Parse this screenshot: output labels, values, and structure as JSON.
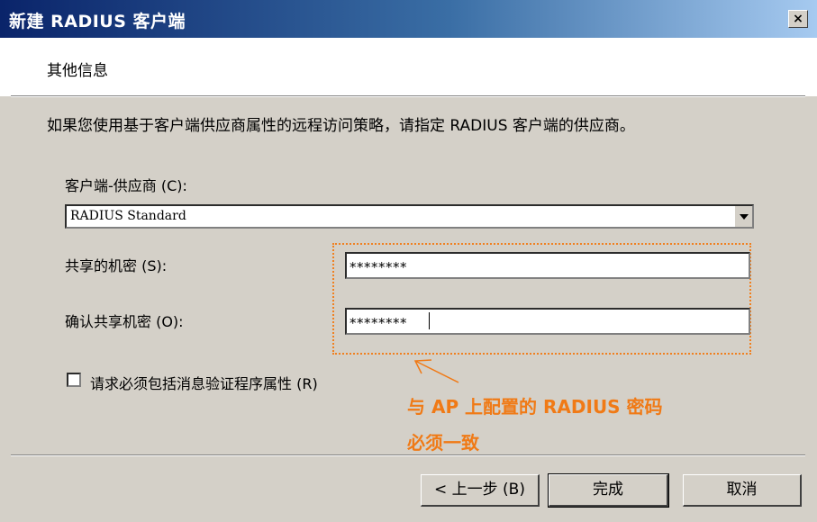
{
  "window": {
    "title": "新建 RADIUS 客户端",
    "close_label": "×"
  },
  "section": {
    "title": "其他信息"
  },
  "description": "如果您使用基于客户端供应商属性的远程访问策略，请指定 RADIUS 客户端的供应商。",
  "vendor": {
    "label": "客户端-供应商 (C):",
    "selected": "RADIUS Standard"
  },
  "shared_secret": {
    "label": "共享的机密 (S):",
    "value": "********"
  },
  "confirm_secret": {
    "label": "确认共享机密 (O):",
    "value": "********"
  },
  "message_auth": {
    "label": "请求必须包括消息验证程序属性 (R)",
    "checked": false
  },
  "annotation": {
    "line1": "与 AP 上配置的 RADIUS 密码",
    "line2": "必须一致",
    "color": "#f07a16"
  },
  "buttons": {
    "back": "< 上一步 (B)",
    "finish": "完成",
    "cancel": "取消"
  }
}
